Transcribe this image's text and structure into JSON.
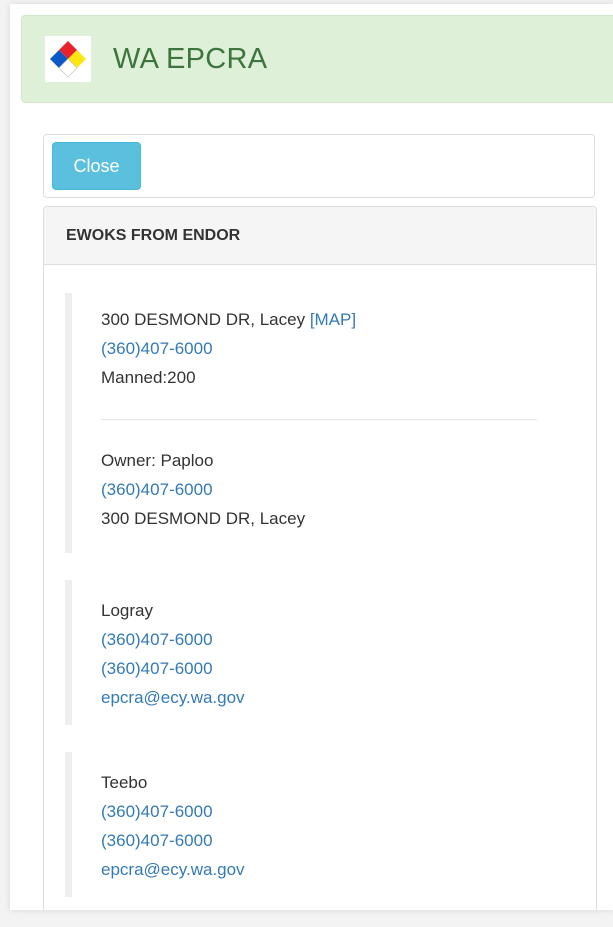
{
  "header": {
    "title": "WA EPCRA",
    "logo_icon": "nfpa-diamond-icon",
    "logo_colors": [
      "#e8232b",
      "#0a59c6",
      "#ffe511",
      "#ffffff"
    ],
    "bg_color": "#dff0d8",
    "text_color": "#3c763d"
  },
  "toolbar": {
    "close_label": "Close",
    "close_color": "#5bc0de"
  },
  "facility": {
    "name": "EWOKS FROM ENDOR",
    "address": "300 DESMOND DR, Lacey",
    "map_link": "[MAP]",
    "phone": "(360)407-6000",
    "manned": "Manned:200",
    "owner": "Owner: Paploo",
    "owner_phone": "(360)407-6000",
    "owner_address": "300 DESMOND DR, Lacey"
  },
  "contacts": [
    {
      "name": "Logray",
      "phone1": "(360)407-6000",
      "phone2": "(360)407-6000",
      "email": "epcra@ecy.wa.gov"
    },
    {
      "name": "Teebo",
      "phone1": "(360)407-6000",
      "phone2": "(360)407-6000",
      "email": "epcra@ecy.wa.gov"
    }
  ],
  "colors": {
    "link": "#337ab7",
    "panel_heading_bg": "#f5f5f5",
    "border": "#dddddd"
  }
}
